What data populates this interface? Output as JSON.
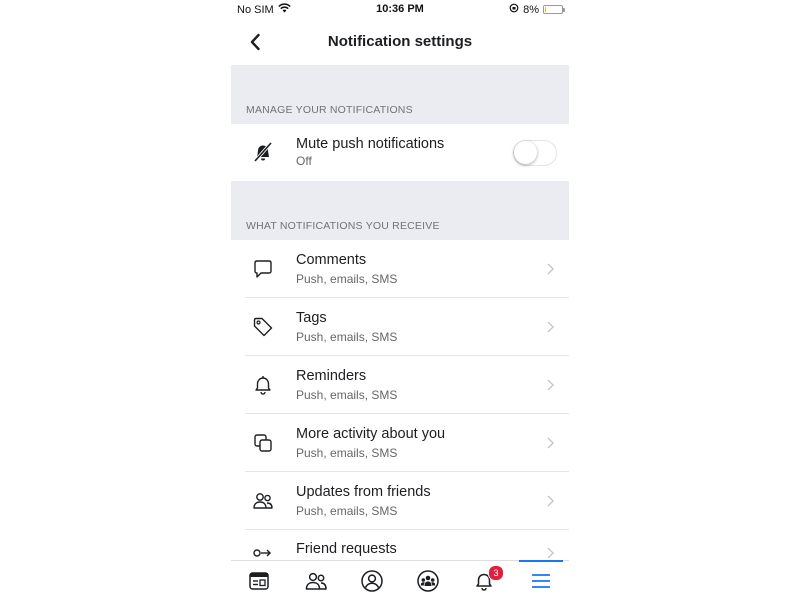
{
  "status_bar": {
    "carrier": "No SIM",
    "time": "10:36 PM",
    "battery": "8%",
    "battery_level": 0.08
  },
  "header": {
    "title": "Notification settings"
  },
  "sections": {
    "manage": {
      "title": "MANAGE YOUR NOTIFICATIONS",
      "mute": {
        "title": "Mute push notifications",
        "subtitle": "Off",
        "toggle_on": false
      }
    },
    "receive": {
      "title": "WHAT NOTIFICATIONS YOU RECEIVE",
      "items": [
        {
          "title": "Comments",
          "subtitle": "Push, emails, SMS",
          "icon": "comment-icon"
        },
        {
          "title": "Tags",
          "subtitle": "Push, emails, SMS",
          "icon": "tag-icon"
        },
        {
          "title": "Reminders",
          "subtitle": "Push, emails, SMS",
          "icon": "bell-icon"
        },
        {
          "title": "More activity about you",
          "subtitle": "Push, emails, SMS",
          "icon": "activity-icon"
        },
        {
          "title": "Updates from friends",
          "subtitle": "Push, emails, SMS",
          "icon": "friends-icon"
        },
        {
          "title": "Friend requests",
          "subtitle": "",
          "icon": "friend-request-icon"
        }
      ]
    }
  },
  "tab_bar": {
    "notification_badge": "3",
    "active_color": "#1877f2"
  },
  "colors": {
    "section_bg": "#ebebf2",
    "accent": "#1877f2",
    "badge": "#e41e3f"
  }
}
